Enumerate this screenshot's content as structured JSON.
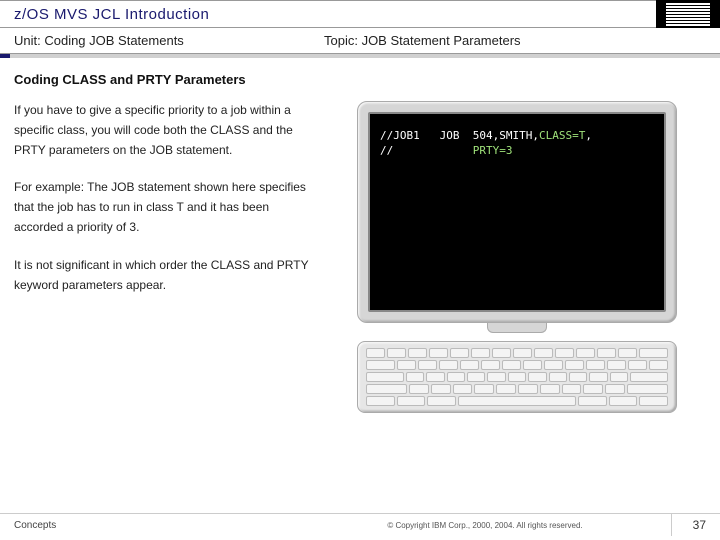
{
  "header": {
    "title": "z/OS MVS JCL Introduction",
    "logo_alt": "IBM"
  },
  "subheader": {
    "unit": "Unit: Coding JOB Statements",
    "topic": "Topic: JOB Statement Parameters"
  },
  "content": {
    "heading": "Coding CLASS and PRTY Parameters",
    "p1": "If you have to give a specific priority to a job within a specific class, you will code both the CLASS and the PRTY parameters on the JOB statement.",
    "p2": "For example: The JOB statement shown here specifies that the job has to run in class T and it has been accorded a priority of 3.",
    "p3": "It is not significant in which order the CLASS and PRTY keyword parameters appear."
  },
  "terminal": {
    "line1_a": "//JOB1   JOB  504,SMITH,",
    "line1_b": "CLASS=T",
    "line1_c": ",",
    "line2_a": "//            ",
    "line2_b": "PRTY=3"
  },
  "footer": {
    "left": "Concepts",
    "center": "© Copyright IBM Corp., 2000, 2004. All rights reserved.",
    "page": "37"
  }
}
